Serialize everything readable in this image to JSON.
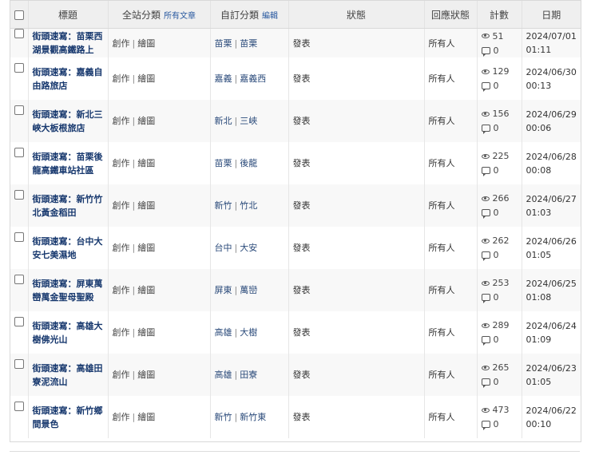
{
  "header": {
    "title": "標題",
    "site_category": "全站分類",
    "site_category_link": "所有文章",
    "custom_category": "自訂分類",
    "custom_category_link": "編輯",
    "status": "狀態",
    "reply_status": "回應狀態",
    "count": "計數",
    "date": "日期"
  },
  "rows": [
    {
      "title": "街頭速寫：苗栗西湖景觀高鐵路上",
      "site_cat": [
        "創作",
        "繪圖"
      ],
      "my_cat": [
        "苗栗",
        "苗栗"
      ],
      "status": "發表",
      "reply": "所有人",
      "views": "51",
      "comments": "0",
      "date": "2024/07/01",
      "time": "01:11"
    },
    {
      "title": "街頭速寫：嘉義自由路旅店",
      "site_cat": [
        "創作",
        "繪圖"
      ],
      "my_cat": [
        "嘉義",
        "嘉義西"
      ],
      "status": "發表",
      "reply": "所有人",
      "views": "129",
      "comments": "0",
      "date": "2024/06/30",
      "time": "00:13"
    },
    {
      "title": "街頭速寫：新北三峽大板根旅店",
      "site_cat": [
        "創作",
        "繪圖"
      ],
      "my_cat": [
        "新北",
        "三峽"
      ],
      "status": "發表",
      "reply": "所有人",
      "views": "156",
      "comments": "0",
      "date": "2024/06/29",
      "time": "00:06"
    },
    {
      "title": "街頭速寫：苗栗後龍高鐵車站社區",
      "site_cat": [
        "創作",
        "繪圖"
      ],
      "my_cat": [
        "苗栗",
        "後龍"
      ],
      "status": "發表",
      "reply": "所有人",
      "views": "225",
      "comments": "0",
      "date": "2024/06/28",
      "time": "00:08"
    },
    {
      "title": "街頭速寫：新竹竹北黃金稻田",
      "site_cat": [
        "創作",
        "繪圖"
      ],
      "my_cat": [
        "新竹",
        "竹北"
      ],
      "status": "發表",
      "reply": "所有人",
      "views": "266",
      "comments": "0",
      "date": "2024/06/27",
      "time": "01:03"
    },
    {
      "title": "街頭速寫：台中大安七美濕地",
      "site_cat": [
        "創作",
        "繪圖"
      ],
      "my_cat": [
        "台中",
        "大安"
      ],
      "status": "發表",
      "reply": "所有人",
      "views": "262",
      "comments": "0",
      "date": "2024/06/26",
      "time": "01:05"
    },
    {
      "title": "街頭速寫：屏東萬巒萬金聖母聖殿",
      "site_cat": [
        "創作",
        "繪圖"
      ],
      "my_cat": [
        "屏東",
        "萬巒"
      ],
      "status": "發表",
      "reply": "所有人",
      "views": "253",
      "comments": "0",
      "date": "2024/06/25",
      "time": "01:08"
    },
    {
      "title": "街頭速寫：高雄大樹佛光山",
      "site_cat": [
        "創作",
        "繪圖"
      ],
      "my_cat": [
        "高雄",
        "大樹"
      ],
      "status": "發表",
      "reply": "所有人",
      "views": "289",
      "comments": "0",
      "date": "2024/06/24",
      "time": "01:09"
    },
    {
      "title": "街頭速寫：高雄田寮泥流山",
      "site_cat": [
        "創作",
        "繪圖"
      ],
      "my_cat": [
        "高雄",
        "田寮"
      ],
      "status": "發表",
      "reply": "所有人",
      "views": "265",
      "comments": "0",
      "date": "2024/06/23",
      "time": "01:05"
    },
    {
      "title": "街頭速寫：新竹鄉間景色",
      "site_cat": [
        "創作",
        "繪圖"
      ],
      "my_cat": [
        "新竹",
        "新竹東"
      ],
      "status": "發表",
      "reply": "所有人",
      "views": "473",
      "comments": "0",
      "date": "2024/06/22",
      "time": "00:10"
    }
  ],
  "icons": {
    "views": "eye-icon",
    "comments": "comment-bubble-icon"
  },
  "colors": {
    "header_bg": "#efefef",
    "title_link": "#17386e",
    "link_blue": "#2a5aa0"
  }
}
